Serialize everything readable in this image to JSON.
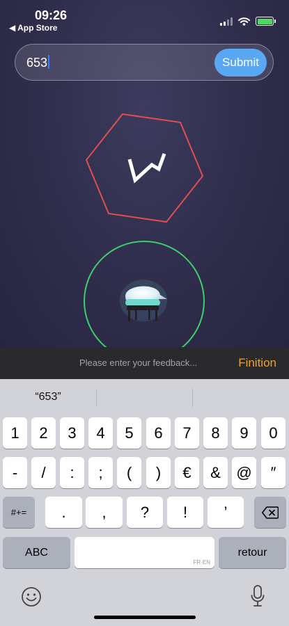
{
  "status_bar": {
    "time": "09:26",
    "back_label": "◀ App Store",
    "battery_color": "#4cd964"
  },
  "input": {
    "value": "653",
    "submit_label": "Submit",
    "submit_color": "#5aa8f3"
  },
  "game": {
    "hexagon_color": "#e04f4f",
    "circle_color": "#3ecf6a",
    "glyph": "zigzag-icon",
    "item": "flask-icon"
  },
  "feedback": {
    "placeholder": "Please enter your feedback...",
    "action_label": "Finition",
    "action_color": "#f0a12a"
  },
  "keyboard": {
    "suggestions": [
      "“653”",
      "",
      ""
    ],
    "row1": [
      "1",
      "2",
      "3",
      "4",
      "5",
      "6",
      "7",
      "8",
      "9",
      "0"
    ],
    "row2": [
      "-",
      "/",
      ":",
      ";",
      "(",
      ")",
      "€",
      "&",
      "@",
      "″"
    ],
    "row3": [
      "#+=",
      ".",
      ",",
      "?",
      "!",
      "’"
    ],
    "abc_label": "ABC",
    "space_hint": "FR·EN",
    "return_label": "retour",
    "icons": [
      "backspace-icon",
      "emoji-icon",
      "microphone-icon"
    ]
  }
}
